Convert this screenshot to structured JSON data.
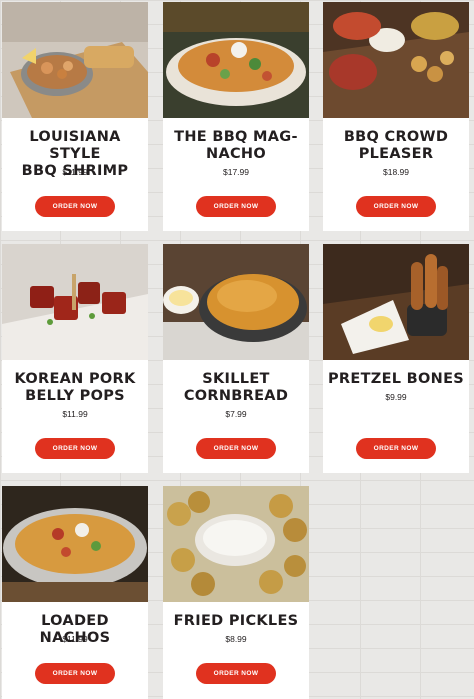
{
  "menu": {
    "items": [
      {
        "title_lines": [
          "LOUISIANA STYLE",
          "BBQ SHRIMP"
        ],
        "price": "$11.99",
        "button": "ORDER NOW",
        "photo_icon": "shrimp-skillet-photo"
      },
      {
        "title_lines": [
          "THE BBQ MAG-",
          "NACHO"
        ],
        "price": "$17.99",
        "button": "ORDER NOW",
        "photo_icon": "nachos-platter-photo"
      },
      {
        "title_lines": [
          "BBQ CROWD",
          "PLEASER"
        ],
        "price": "$18.99",
        "button": "ORDER NOW",
        "photo_icon": "platter-board-photo"
      },
      {
        "title_lines": [
          "KOREAN PORK",
          "BELLY POPS"
        ],
        "price": "$11.99",
        "button": "ORDER NOW",
        "photo_icon": "pork-belly-photo"
      },
      {
        "title_lines": [
          "SKILLET",
          "CORNBREAD"
        ],
        "price": "$7.99",
        "button": "ORDER NOW",
        "photo_icon": "cornbread-skillet-photo"
      },
      {
        "title_lines": [
          "PRETZEL BONES"
        ],
        "price": "$9.99",
        "button": "ORDER NOW",
        "photo_icon": "pretzel-photo"
      },
      {
        "title_lines": [
          "LOADED NACHOS"
        ],
        "price": "$11.99",
        "button": "ORDER NOW",
        "photo_icon": "loaded-nachos-photo"
      },
      {
        "title_lines": [
          "FRIED PICKLES"
        ],
        "price": "$8.99",
        "button": "ORDER NOW",
        "photo_icon": "fried-pickles-photo"
      }
    ]
  },
  "colors": {
    "button": "#e0321f",
    "text": "#231f20",
    "card": "#ffffff",
    "background": "#e9e8e6"
  }
}
